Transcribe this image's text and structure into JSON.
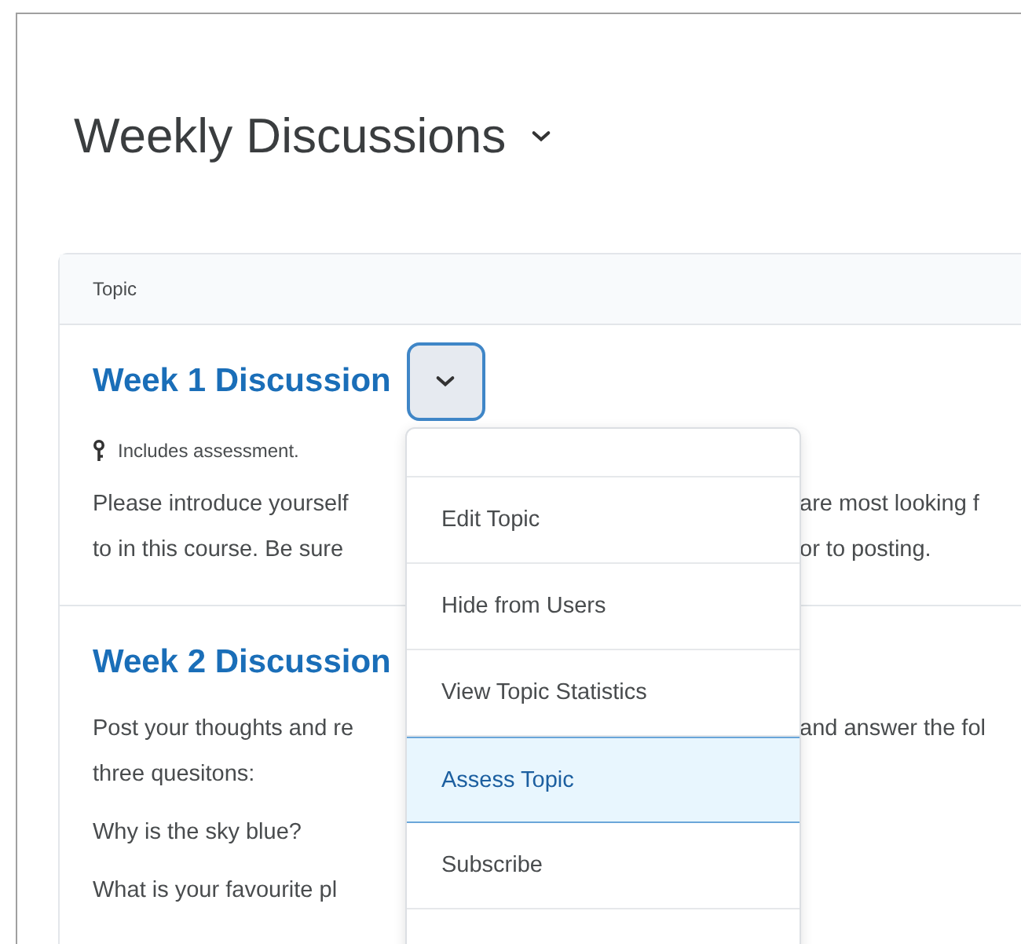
{
  "page_title": "Weekly Discussions",
  "table": {
    "column": "Topic",
    "topics": [
      {
        "title": "Week 1 Discussion",
        "menu_button": {
          "expanded": true
        },
        "note": "Includes assessment.",
        "paragraphs": [
          [
            {
              "left": "Please introduce yourself",
              "right": "are most looking f"
            },
            {
              "left": "to in this course. Be sure",
              "right": "or to posting."
            }
          ]
        ]
      },
      {
        "title": "Week 2 Discussion",
        "paragraphs": [
          [
            {
              "left": "Post your thoughts and re",
              "right": "and answer the fol"
            },
            {
              "left": "three quesitons:"
            }
          ],
          [
            {
              "left": "Why is the sky blue?"
            }
          ],
          [
            {
              "left": "What is your favourite pl"
            }
          ]
        ]
      }
    ]
  },
  "context_menu": {
    "items": [
      {
        "label": "Edit Topic",
        "selected": false
      },
      {
        "label": "Hide from Users",
        "selected": false
      },
      {
        "label": "View Topic Statistics",
        "selected": false
      },
      {
        "label": "Assess Topic",
        "selected": true
      },
      {
        "label": "Subscribe",
        "selected": false
      }
    ]
  }
}
